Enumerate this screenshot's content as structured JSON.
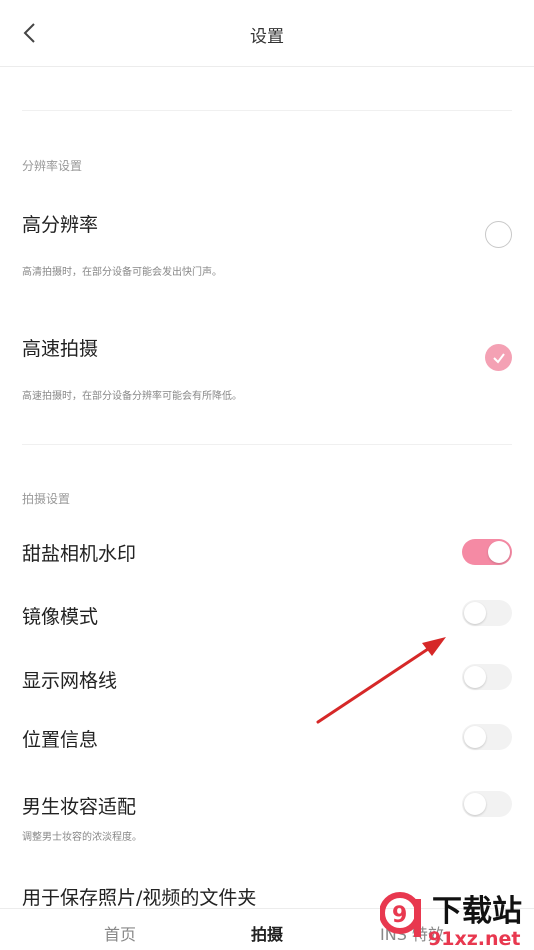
{
  "header": {
    "title": "设置"
  },
  "resolution_section": {
    "title": "分辨率设置",
    "items": [
      {
        "label": "高分辨率",
        "desc": "高清拍摄时，在部分设备可能会发出快门声。",
        "selected": false
      },
      {
        "label": "高速拍摄",
        "desc": "高速拍摄时，在部分设备分辨率可能会有所降低。",
        "selected": true
      }
    ]
  },
  "capture_section": {
    "title": "拍摄设置",
    "items": [
      {
        "label": "甜盐相机水印",
        "on": true
      },
      {
        "label": "镜像模式",
        "on": false
      },
      {
        "label": "显示网格线",
        "on": false
      },
      {
        "label": "位置信息",
        "on": false
      },
      {
        "label": "男生妆容适配",
        "desc": "调整男士妆容的浓淡程度。",
        "on": false
      }
    ],
    "folder_label": "用于保存照片/视频的文件夹"
  },
  "bottom_nav": {
    "items": [
      {
        "label": "首页"
      },
      {
        "label": "拍摄"
      },
      {
        "label": "INS 特效"
      }
    ]
  },
  "watermark": {
    "text": "下载站",
    "url_text": "91xz.net",
    "number": "9"
  },
  "colors": {
    "accent": "#f58aa4",
    "radio_checked": "#f4a1b4",
    "arrow": "#d62828"
  }
}
